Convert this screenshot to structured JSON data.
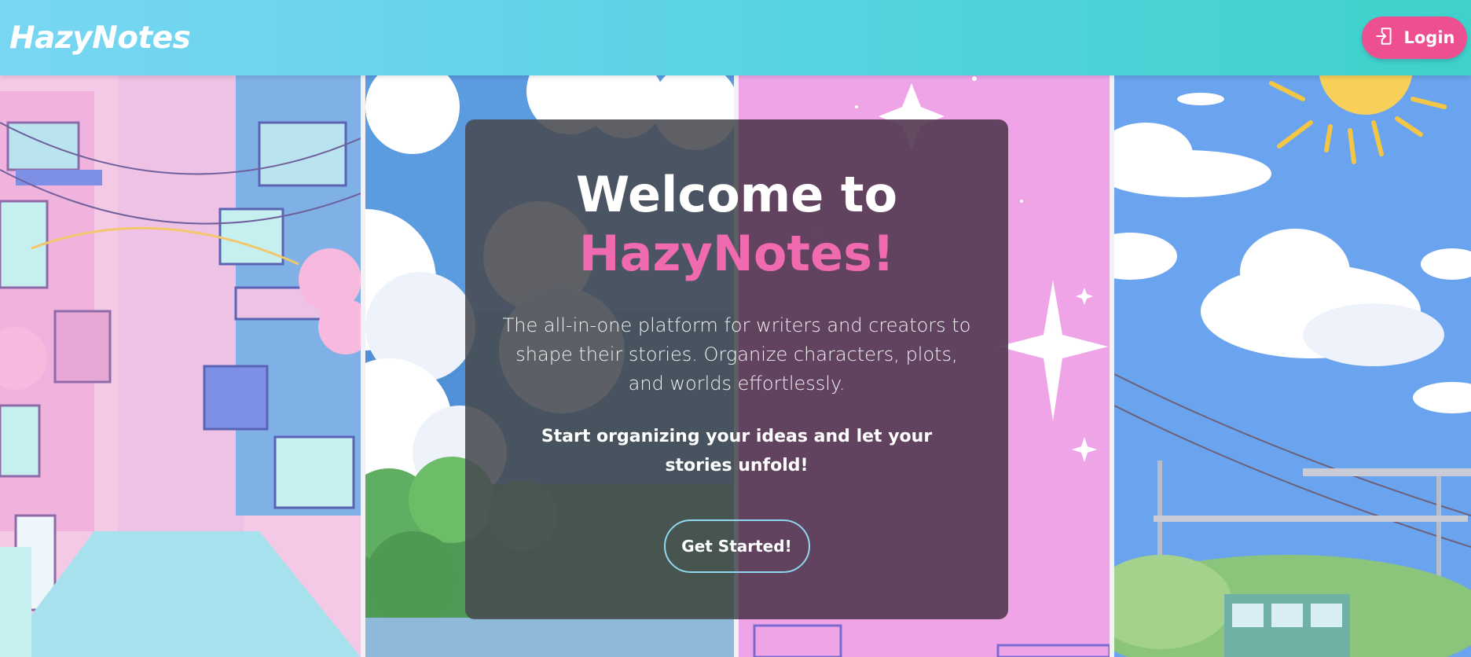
{
  "header": {
    "logo": "HazyNotes",
    "login_label": "Login",
    "login_icon": "login-icon"
  },
  "hero": {
    "title_line1": "Welcome to",
    "title_line2": "HazyNotes!",
    "description": "The all-in-one platform for writers and creators to shape their stories. Organize characters, plots, and worlds effortlessly.",
    "cta_text": "Start organizing your ideas and let your stories unfold!",
    "button_label": "Get Started!"
  },
  "colors": {
    "header_gradient_start": "#79d6f3",
    "header_gradient_end": "#3ed2cb",
    "accent_pink": "#ee4f91",
    "title_pink": "#f06ab0",
    "button_border": "#8fd8ef"
  },
  "background_panels": [
    "pastel-city-street",
    "clouds-and-trees",
    "pink-sparkle-sky",
    "sunny-sky-train"
  ]
}
